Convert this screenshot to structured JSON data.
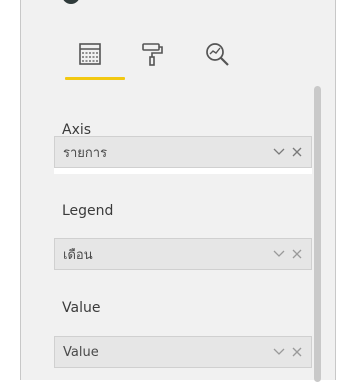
{
  "toolbar": {
    "tabs": [
      {
        "icon": "fields-icon",
        "active": true
      },
      {
        "icon": "format-paint-roller-icon",
        "active": false
      },
      {
        "icon": "analytics-magnifier-icon",
        "active": false
      }
    ],
    "accent_color": "#f2c811"
  },
  "wells": {
    "axis": {
      "label": "Axis",
      "value": "รายการ"
    },
    "legend": {
      "label": "Legend",
      "value": "เดือน"
    },
    "value": {
      "label": "Value",
      "value": "Value"
    }
  }
}
